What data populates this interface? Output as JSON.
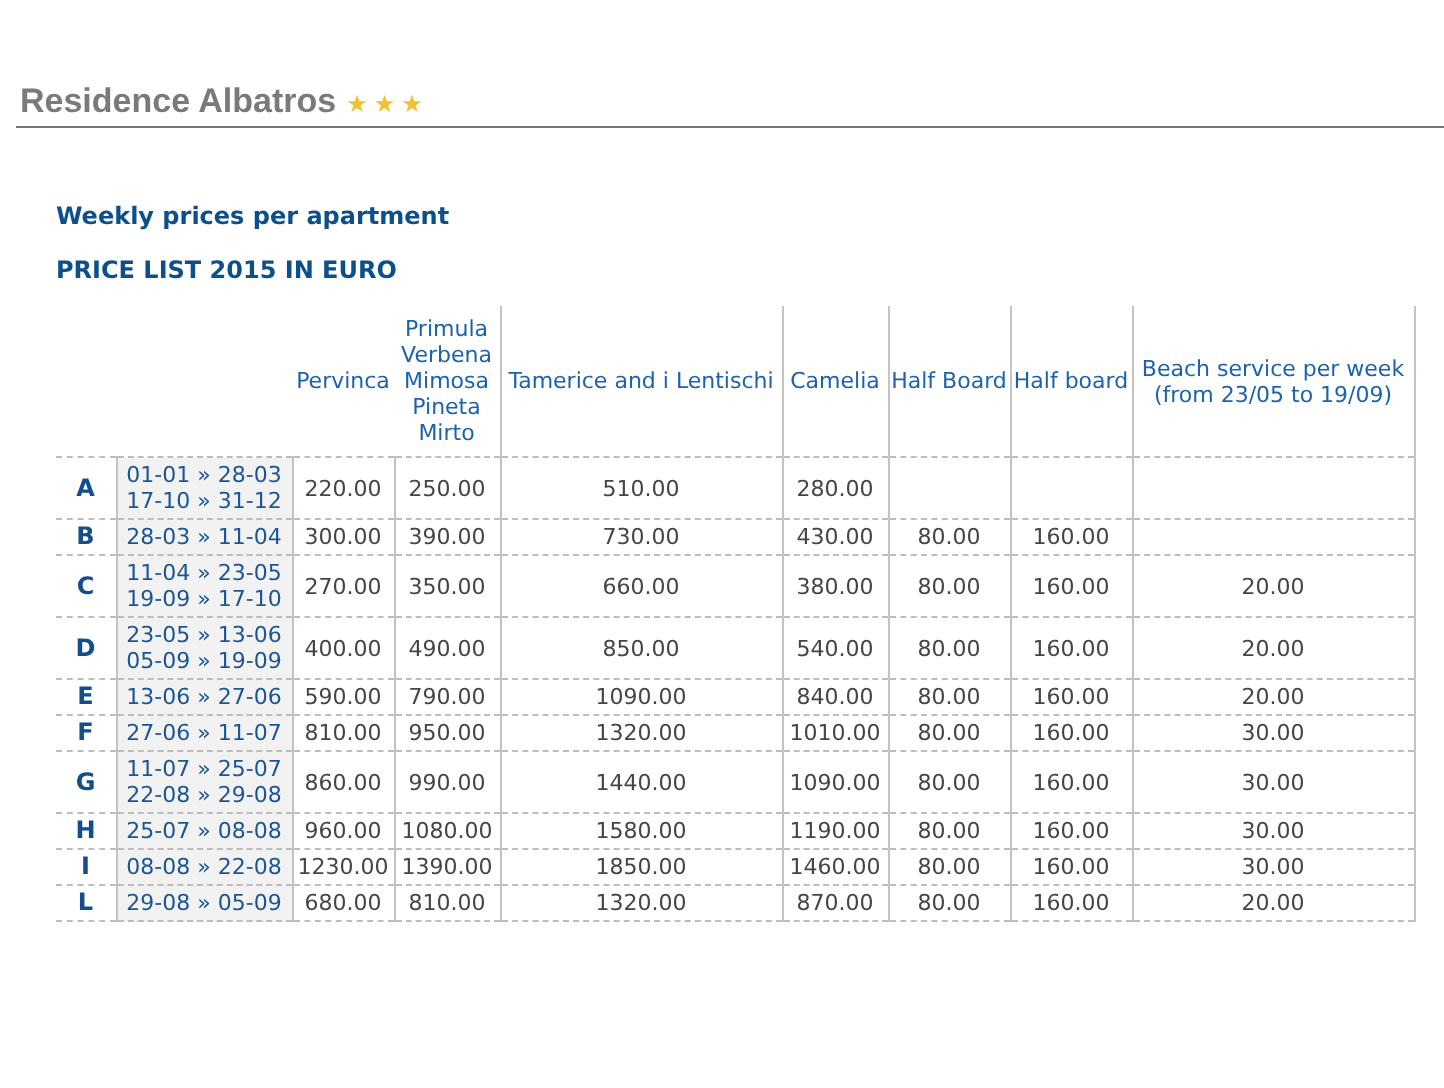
{
  "header": {
    "title": "Residence Albatros",
    "stars": 3
  },
  "subtitle": "Weekly prices per apartment",
  "price_list_title": "PRICE LIST 2015 IN EURO",
  "table": {
    "columns": [
      "Pervinca",
      "Primula Verbena Mimosa Pineta Mirto",
      "Tamerice and i Lentischi",
      "Camelia",
      "Half Board",
      "Half board",
      "Beach service per week (from 23/05 to 19/09)"
    ],
    "rows": [
      {
        "letter": "A",
        "periods": [
          "01-01 » 28-03",
          "17-10 » 31-12"
        ],
        "prices": [
          "220.00",
          "250.00",
          "510.00",
          "280.00"
        ]
      },
      {
        "letter": "B",
        "periods": [
          "28-03 » 11-04"
        ],
        "prices": [
          "300.00",
          "390.00",
          "730.00",
          "430.00",
          "80.00",
          "160.00"
        ]
      },
      {
        "letter": "C",
        "periods": [
          "11-04 » 23-05",
          "19-09 » 17-10"
        ],
        "prices": [
          "270.00",
          "350.00",
          "660.00",
          "380.00",
          "80.00",
          "160.00",
          "20.00"
        ]
      },
      {
        "letter": "D",
        "periods": [
          "23-05 » 13-06",
          "05-09 » 19-09"
        ],
        "prices": [
          "400.00",
          "490.00",
          "850.00",
          "540.00",
          "80.00",
          "160.00",
          "20.00"
        ]
      },
      {
        "letter": "E",
        "periods": [
          "13-06 » 27-06"
        ],
        "prices": [
          "590.00",
          "790.00",
          "1090.00",
          "840.00",
          "80.00",
          "160.00",
          "20.00"
        ]
      },
      {
        "letter": "F",
        "periods": [
          "27-06 » 11-07"
        ],
        "prices": [
          "810.00",
          "950.00",
          "1320.00",
          "1010.00",
          "80.00",
          "160.00",
          "30.00"
        ]
      },
      {
        "letter": "G",
        "periods": [
          "11-07 » 25-07",
          "22-08 » 29-08"
        ],
        "prices": [
          "860.00",
          "990.00",
          "1440.00",
          "1090.00",
          "80.00",
          "160.00",
          "30.00"
        ]
      },
      {
        "letter": "H",
        "periods": [
          "25-07 » 08-08"
        ],
        "prices": [
          "960.00",
          "1080.00",
          "1580.00",
          "1190.00",
          "80.00",
          "160.00",
          "30.00"
        ]
      },
      {
        "letter": "I",
        "periods": [
          "08-08 » 22-08"
        ],
        "prices": [
          "1230.00",
          "1390.00",
          "1850.00",
          "1460.00",
          "80.00",
          "160.00",
          "30.00"
        ]
      },
      {
        "letter": "L",
        "periods": [
          "29-08 » 05-09"
        ],
        "prices": [
          "680.00",
          "810.00",
          "1320.00",
          "870.00",
          "80.00",
          "160.00",
          "20.00"
        ]
      }
    ]
  }
}
